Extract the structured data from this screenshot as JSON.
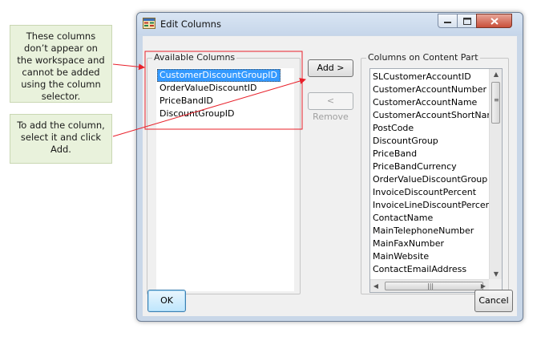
{
  "callouts": {
    "not_on_workspace": "These columns don’t appear on the workspace and cannot be added using the column selector.",
    "how_to_add": "To add the column, select it and click Add."
  },
  "dialog": {
    "title": "Edit Columns",
    "available": {
      "label": "Available Columns",
      "items": [
        "CustomerDiscountGroupID",
        "OrderValueDiscountID",
        "PriceBandID",
        "DiscountGroupID"
      ],
      "selected_index": 0
    },
    "content_part": {
      "label": "Columns on Content Part",
      "items": [
        "SLCustomerAccountID",
        "CustomerAccountNumber",
        "CustomerAccountName",
        "CustomerAccountShortName",
        "PostCode",
        "DiscountGroup",
        "PriceBand",
        "PriceBandCurrency",
        "OrderValueDiscountGroup",
        "InvoiceDiscountPercent",
        "InvoiceLineDiscountPercent",
        "ContactName",
        "MainTelephoneNumber",
        "MainFaxNumber",
        "MainWebsite",
        "ContactEmailAddress"
      ]
    },
    "buttons": {
      "add": "Add >",
      "remove": "< Remove",
      "ok": "OK",
      "cancel": "Cancel"
    }
  },
  "colors": {
    "arrow": "#e8202a",
    "selection": "#3399ff",
    "callout_bg": "#e9f2dc"
  }
}
